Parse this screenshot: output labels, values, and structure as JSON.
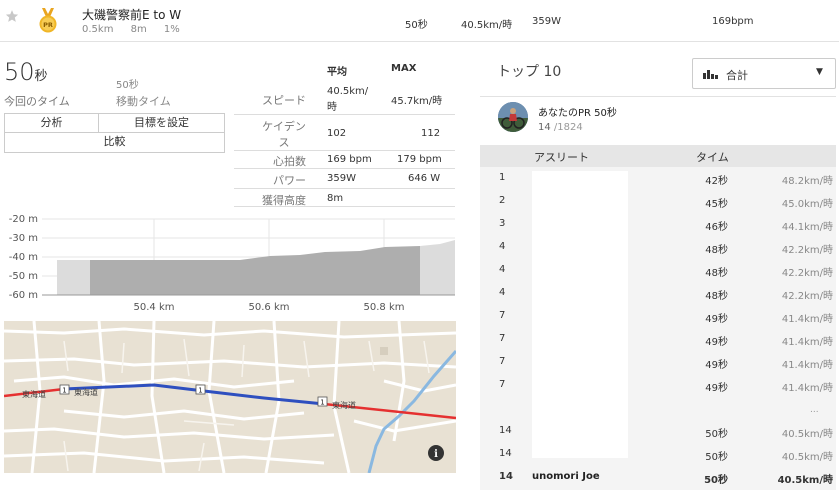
{
  "header": {
    "segment_name": "大磯警察前E to W",
    "pr_badge": "PR",
    "distance": "0.5km",
    "elevation": "8m",
    "grade": "1%",
    "time": "50秒",
    "speed": "40.5km/時",
    "power": "359W",
    "heart_rate": "169bpm"
  },
  "summary": {
    "time_value": "50",
    "time_unit": "秒",
    "time_label": "今回のタイム",
    "moving_time": "50秒",
    "moving_label": "移動タイム"
  },
  "buttons": {
    "analysis": "分析",
    "set_goal": "目標を設定",
    "compare": "比較"
  },
  "stats": {
    "col_avg": "平均",
    "col_max": "MAX",
    "rows": [
      {
        "label": "スピード",
        "avg": "40.5km/時",
        "max": "45.7km/時"
      },
      {
        "label": "ケイデンス",
        "avg": "102",
        "max": "112"
      },
      {
        "label": "心拍数",
        "avg": "169 bpm",
        "max": "179 bpm"
      },
      {
        "label": "パワー",
        "avg": "359W",
        "max": "646 W"
      },
      {
        "label": "獲得高度",
        "avg": "8m",
        "max": ""
      }
    ]
  },
  "elevation_chart": {
    "y_ticks": [
      "-20 m",
      "-30 m",
      "-40 m",
      "-50 m",
      "-60 m"
    ],
    "x_ticks": [
      "50.4 km",
      "50.6 km",
      "50.8 km"
    ]
  },
  "map": {
    "road_label": "東海道",
    "route_number": "1",
    "info_icon": "i"
  },
  "leaderboard": {
    "title": "トップ 10",
    "filter": "合計",
    "my_pr_label": "あなたのPR 50秒",
    "my_rank": "14",
    "my_rank_total": "/1824",
    "col_athlete": "アスリート",
    "col_time": "タイム",
    "rows": [
      {
        "rank": "1",
        "time": "42秒",
        "speed": "48.2km/時"
      },
      {
        "rank": "2",
        "time": "45秒",
        "speed": "45.0km/時"
      },
      {
        "rank": "3",
        "time": "46秒",
        "speed": "44.1km/時"
      },
      {
        "rank": "4",
        "time": "48秒",
        "speed": "42.2km/時"
      },
      {
        "rank": "4",
        "time": "48秒",
        "speed": "42.2km/時"
      },
      {
        "rank": "4",
        "time": "48秒",
        "speed": "42.2km/時"
      },
      {
        "rank": "7",
        "time": "49秒",
        "speed": "41.4km/時"
      },
      {
        "rank": "7",
        "time": "49秒",
        "speed": "41.4km/時"
      },
      {
        "rank": "7",
        "time": "49秒",
        "speed": "41.4km/時"
      },
      {
        "rank": "7",
        "time": "49秒",
        "speed": "41.4km/時"
      }
    ],
    "ellipsis": "...",
    "tail_rows": [
      {
        "rank": "14",
        "time": "50秒",
        "speed": "40.5km/時"
      },
      {
        "rank": "14",
        "time": "50秒",
        "speed": "40.5km/時"
      }
    ],
    "me": {
      "rank": "14",
      "name": "unomori Joe",
      "time": "50秒",
      "speed": "40.5km/時"
    }
  },
  "colors": {
    "route_blue": "#2e4fbf",
    "route_red": "#e53030",
    "map_bg": "#e8e1d3",
    "medal_gold": "#f0b627"
  }
}
